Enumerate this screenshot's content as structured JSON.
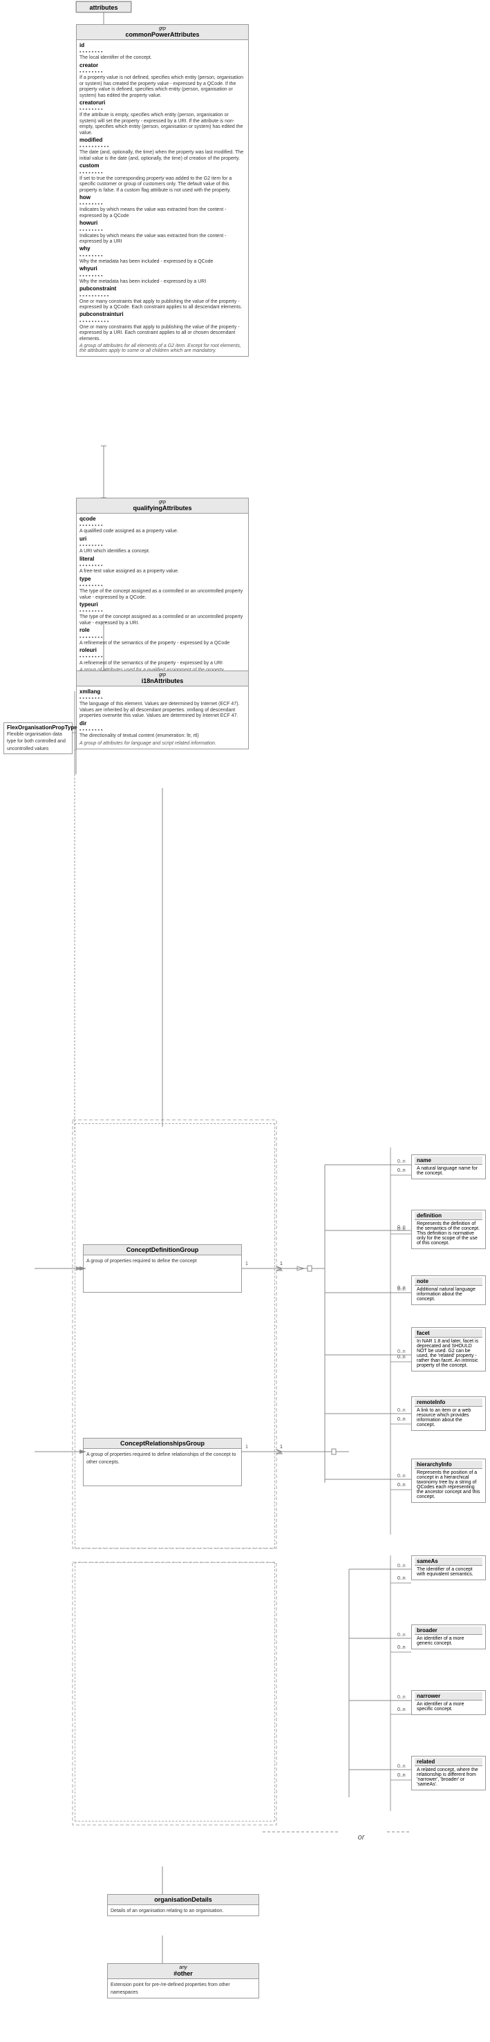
{
  "title": "attributes",
  "mainBox": {
    "stereotype": "grp",
    "name": "commonPowerAttributes",
    "fields": [
      {
        "name": "id",
        "dots": "▪▪▪▪▪▪▪▪",
        "desc": "The local identifier of the concept."
      },
      {
        "name": "creator",
        "dots": "▪▪▪▪▪▪▪▪",
        "desc": "If a property value is not defined, specifies which entity (person, organisation or system) has created the property value - expressed by a QCode. If the property value is defined, specifies which entity (person, organisation or system) has edited the property value."
      },
      {
        "name": "creatoruri",
        "dots": "▪▪▪▪▪▪▪▪",
        "desc": "If the attribute is empty, specifies which entity (person, organisation or system) will set the property - expressed by a URI. If the attribute is non-empty, specifies which entity (person, organisation or system) has edited the value."
      },
      {
        "name": "modified",
        "dots": "▪▪▪▪▪▪▪▪▪▪",
        "desc": "The date (and, optionally, the time) when the property was last modified. The initial value is the date (and, optionally, the time) of creation of the property."
      },
      {
        "name": "custom",
        "dots": "▪▪▪▪▪▪▪▪",
        "desc": "If set to true the corresponding property was added to the G2 item for a specific customer or group of customers only. The default value of this property is false. If a custom flag attribute is not used with the property."
      },
      {
        "name": "how",
        "dots": "▪▪▪▪▪▪▪▪",
        "desc": "Indicates by which means the value was extracted from the content - expressed by a QCode"
      },
      {
        "name": "howuri",
        "dots": "▪▪▪▪▪▪▪▪",
        "desc": "Indicates by which means the value was extracted from the content - expressed by a URI"
      },
      {
        "name": "why",
        "dots": "▪▪▪▪▪▪▪▪",
        "desc": "Why the metadata has been included - expressed by a QCode"
      },
      {
        "name": "whyuri",
        "dots": "▪▪▪▪▪▪▪▪",
        "desc": "Why the metadata has been included - expressed by a URI"
      },
      {
        "name": "pubconstraint",
        "dots": "▪▪▪▪▪▪▪▪▪▪",
        "desc": "One or many constraints that apply to publishing the value of the property - expressed by a QCode. Each constraint applies to all descendant elements."
      },
      {
        "name": "pubconstrainturi",
        "dots": "▪▪▪▪▪▪▪▪▪▪",
        "desc": "One or many constraints that apply to publishing the value of the property - expressed by a URI. Each constraint applies to all or chosen descendant elements."
      },
      {
        "name": "sectionLabel",
        "text": "A group of attributes for all elements of a G2 item. Except for root elements, the attributes apply to some or all children which are mandatory."
      }
    ]
  },
  "qualifyingBox": {
    "stereotype": "grp",
    "name": "qualifyingAttributes",
    "fields": [
      {
        "name": "qcode",
        "dots": "▪▪▪▪▪▪▪▪",
        "desc": "A qualified code assigned as a property value."
      },
      {
        "name": "uri",
        "dots": "▪▪▪▪▪▪▪▪",
        "desc": "A URI which identifies a concept."
      },
      {
        "name": "literal",
        "dots": "▪▪▪▪▪▪▪▪",
        "desc": "A free-text value assigned as a property value."
      },
      {
        "name": "type",
        "dots": "▪▪▪▪▪▪▪▪",
        "desc": "The type of the concept assigned as a controlled or an uncontrolled property value - expressed by a QCode."
      },
      {
        "name": "typeuri",
        "dots": "▪▪▪▪▪▪▪▪",
        "desc": "The type of the concept assigned as a controlled or an uncontrolled property value - expressed by a URI."
      },
      {
        "name": "role",
        "dots": "▪▪▪▪▪▪▪▪",
        "desc": "A refinement of the semantics of the property - expressed by a QCode"
      },
      {
        "name": "roleuri",
        "dots": "▪▪▪▪▪▪▪▪",
        "desc": "A refinement of the semantics of the property - expressed by a URI"
      },
      {
        "name": "sectionLabel",
        "text": "A group of attributes used for a qualified assignment of the property."
      }
    ]
  },
  "i18nBox": {
    "stereotype": "grp",
    "name": "i18nAttributes",
    "fields": [
      {
        "name": "xmllang",
        "dots": "▪▪▪▪▪▪▪▪",
        "desc": "The language of this element. Values are determined by Internet (ECF 47). Values are inherited by all descendant properties. xmllang of descendant properties overwrite this value. Values are determined by Internet ECF 47."
      },
      {
        "name": "dir",
        "dots": "▪▪▪▪▪▪▪▪",
        "desc": "The directionality of textual content (enumeration: ltr, rtl)"
      },
      {
        "name": "sectionLabel",
        "text": "A group of attributes for language and script related information."
      }
    ]
  },
  "flexOrgLabel": {
    "name": "FlexOrganisationPropType",
    "desc": "Flexible organisation data type for both controlled and uncontrolled values"
  },
  "rightBoxes": [
    {
      "id": "name",
      "name": "name",
      "desc": "A natural language name for the concept."
    },
    {
      "id": "definition",
      "name": "definition",
      "desc": "Represents the definition of the semantics of the concept. This definition is normative only for the scope of the use of this concept."
    },
    {
      "id": "note",
      "name": "note",
      "desc": "Additional natural language information about the concept."
    },
    {
      "id": "facet",
      "name": "facet",
      "desc": "In NAR 1.8 and later, facet is deprecated and SHOULD NOT be used. G2 can be used, the 'related' property - rather than facet. An intrinsic property of the concept."
    },
    {
      "id": "remoteInfo",
      "name": "remoteInfo",
      "desc": "A link to an item or a web resource which provides information about the concept."
    },
    {
      "id": "hierarchyInfo",
      "name": "hierarchyInfo",
      "desc": "Represents the position of a concept in a hierarchical taxonomy tree by a string of QCodes each representing the ancestor concept and this concept."
    },
    {
      "id": "sameAs",
      "name": "sameAs",
      "desc": "The identifier of a concept with equivalent semantics."
    },
    {
      "id": "broader",
      "name": "broader",
      "desc": "An identifier of a more generic concept."
    },
    {
      "id": "narrower",
      "name": "narrower",
      "desc": "An identifier of a more specific concept."
    },
    {
      "id": "related",
      "name": "related",
      "desc": "A related concept, where the relationship is different from 'narrower', 'broader' or 'sameAs'."
    }
  ],
  "conceptDefBox": {
    "name": "ConceptDefinitionGroup",
    "desc": "A group of properties required to define the concept"
  },
  "conceptRelBox": {
    "name": "ConceptRelationshipsGroup",
    "desc": "A group of properties required to define relationships of the concept to other concepts."
  },
  "orgDetailsBox": {
    "name": "organisationDetails",
    "desc": "Details of an organisation relating to an organisation."
  },
  "otherBox": {
    "stereotype": "any",
    "name": "#other",
    "desc": "Extension point for pre-/re-defined properties from other namespaces"
  },
  "orLabel": "or",
  "multiplicities": {
    "conceptDefToName": "0..n",
    "conceptDefToDef": "0..n",
    "conceptDefToNote": "0..n",
    "conceptDefToFacet": "0..n",
    "conceptDefToRemote": "0..n",
    "conceptDefToHierarchy": "0..n",
    "conceptRelToSameAs": "0..n",
    "conceptRelToBroader": "0..n",
    "conceptRelToNarrower": "0..n",
    "conceptRelToRelated": "0..n"
  }
}
